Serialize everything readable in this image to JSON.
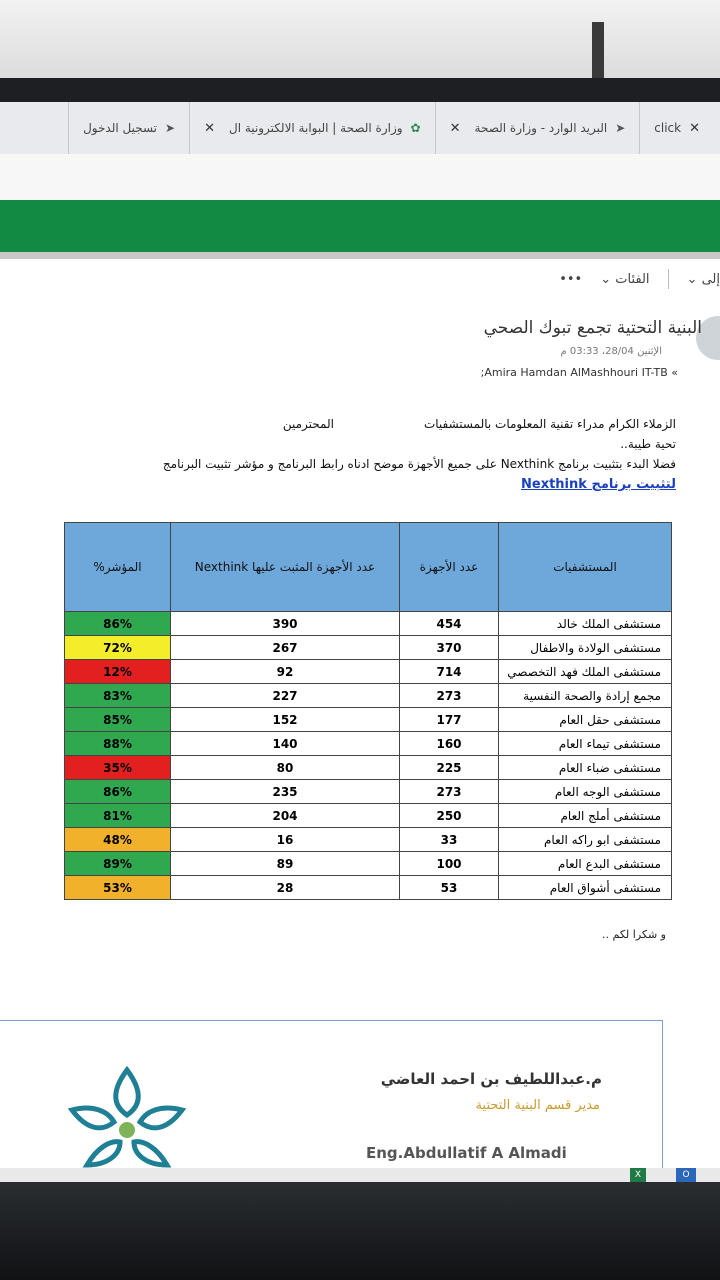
{
  "browser": {
    "tabs": [
      {
        "label": "البريد الوارد - وزارة الصحة",
        "icon": "paper-plane-icon"
      },
      {
        "label": "وزارة الصحة | البوابة الالكترونية ال",
        "icon": "ministry-logo-icon"
      },
      {
        "label": "تسجيل الدخول",
        "icon": "paper-plane-icon"
      }
    ],
    "partial_tab": "click"
  },
  "toolbar": {
    "to_label": "إلى",
    "categories_label": "الفئات",
    "more_label": "•••"
  },
  "email": {
    "subject": "البنية التحتية تجمع تبوك الصحي",
    "date": "الإثنين 28/04، 03:33 م",
    "sender": "Amira Hamdan AlMashhouri IT-TB;",
    "greeting": "الزملاء الكرام مدراء تقنية المعلومات بالمستشفيات",
    "respected": "المحترمين",
    "salutation": "تحية طيبة..",
    "request": "فضلا البدء بتثبيت برنامج Nexthink على جميع الأجهزة موضح ادناه رابط البرنامج و مؤشر تثبيت البرنامج",
    "link_text": "لتثبيت برنامج Nexthink",
    "thanks": "و شكرا لكم .."
  },
  "table": {
    "headers": [
      "المستشفيات",
      "عدد الأجهزة",
      "عدد الأجهزة المثبت عليها Nexthink",
      "المؤشر%"
    ],
    "rows": [
      {
        "hospital": "مستشفى الملك خالد",
        "devices": "454",
        "installed": "390",
        "percent": "86%",
        "status": "green"
      },
      {
        "hospital": "مستشفى الولادة والاطفال",
        "devices": "370",
        "installed": "267",
        "percent": "72%",
        "status": "yellow"
      },
      {
        "hospital": "مستشفى الملك فهد التخصصي",
        "devices": "714",
        "installed": "92",
        "percent": "12%",
        "status": "red"
      },
      {
        "hospital": "مجمع إرادة والصحة النفسية",
        "devices": "273",
        "installed": "227",
        "percent": "83%",
        "status": "green"
      },
      {
        "hospital": "مستشفى حقل العام",
        "devices": "177",
        "installed": "152",
        "percent": "85%",
        "status": "green"
      },
      {
        "hospital": "مستشفى تيماء العام",
        "devices": "160",
        "installed": "140",
        "percent": "88%",
        "status": "green"
      },
      {
        "hospital": "مستشفى ضباء العام",
        "devices": "225",
        "installed": "80",
        "percent": "35%",
        "status": "red"
      },
      {
        "hospital": "مستشفى الوجه العام",
        "devices": "273",
        "installed": "235",
        "percent": "86%",
        "status": "green"
      },
      {
        "hospital": "مستشفى أملج العام",
        "devices": "250",
        "installed": "204",
        "percent": "81%",
        "status": "green"
      },
      {
        "hospital": "مستشفى ابو راكه العام",
        "devices": "33",
        "installed": "16",
        "percent": "48%",
        "status": "orange"
      },
      {
        "hospital": "مستشفى البدع العام",
        "devices": "100",
        "installed": "89",
        "percent": "89%",
        "status": "green"
      },
      {
        "hospital": "مستشفى أشواق العام",
        "devices": "53",
        "installed": "28",
        "percent": "53%",
        "status": "orange"
      }
    ]
  },
  "signature": {
    "name_ar": "م.عبداللطيف بن احمد العاضي",
    "title_ar": "مدير قسم البنية التحتية",
    "name_en": "Eng.Abdullatif A Almadi"
  },
  "colors": {
    "green": "#2fa84f",
    "yellow": "#f4ee2a",
    "red": "#e32020",
    "orange": "#f2b12a",
    "header_blue": "#6ea8db",
    "brand_green": "#138a44"
  }
}
